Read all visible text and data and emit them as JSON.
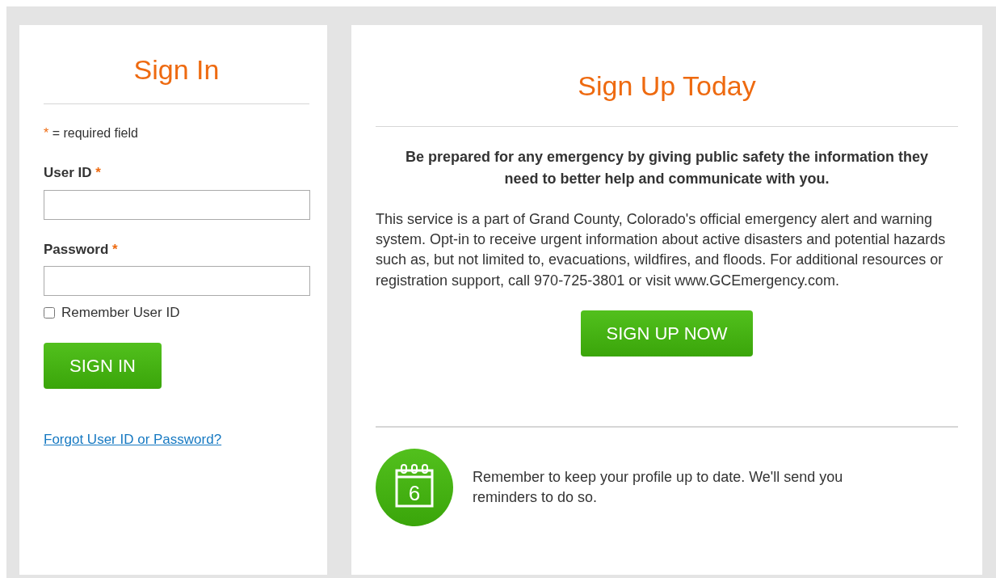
{
  "sign_in": {
    "title": "Sign In",
    "required_note": {
      "mark": "*",
      "text": "= required field"
    },
    "fields": [
      {
        "label": "User ID",
        "required": true
      },
      {
        "label": "Password",
        "required": true
      }
    ],
    "remember": {
      "label": "Remember User ID",
      "checked": false
    },
    "button": "SIGN IN",
    "forgot_link": "Forgot User ID or Password?"
  },
  "sign_up": {
    "title": "Sign Up Today",
    "lead": "Be prepared for any emergency by giving public safety the information they need to better help and communicate with you.",
    "body": "This service is a part of Grand County, Colorado's official emergency alert and warning system. Opt-in to receive urgent information about active disasters and potential hazards such as, but not limited to, evacuations, wildfires, and floods. For additional resources or registration support, call 970-725-3801 or visit www.GCEmergency.com.",
    "button": "SIGN UP NOW",
    "reminder": {
      "calendar_day": "6",
      "text": "Remember to keep your profile up to date. We'll send you reminders to do so."
    }
  }
}
